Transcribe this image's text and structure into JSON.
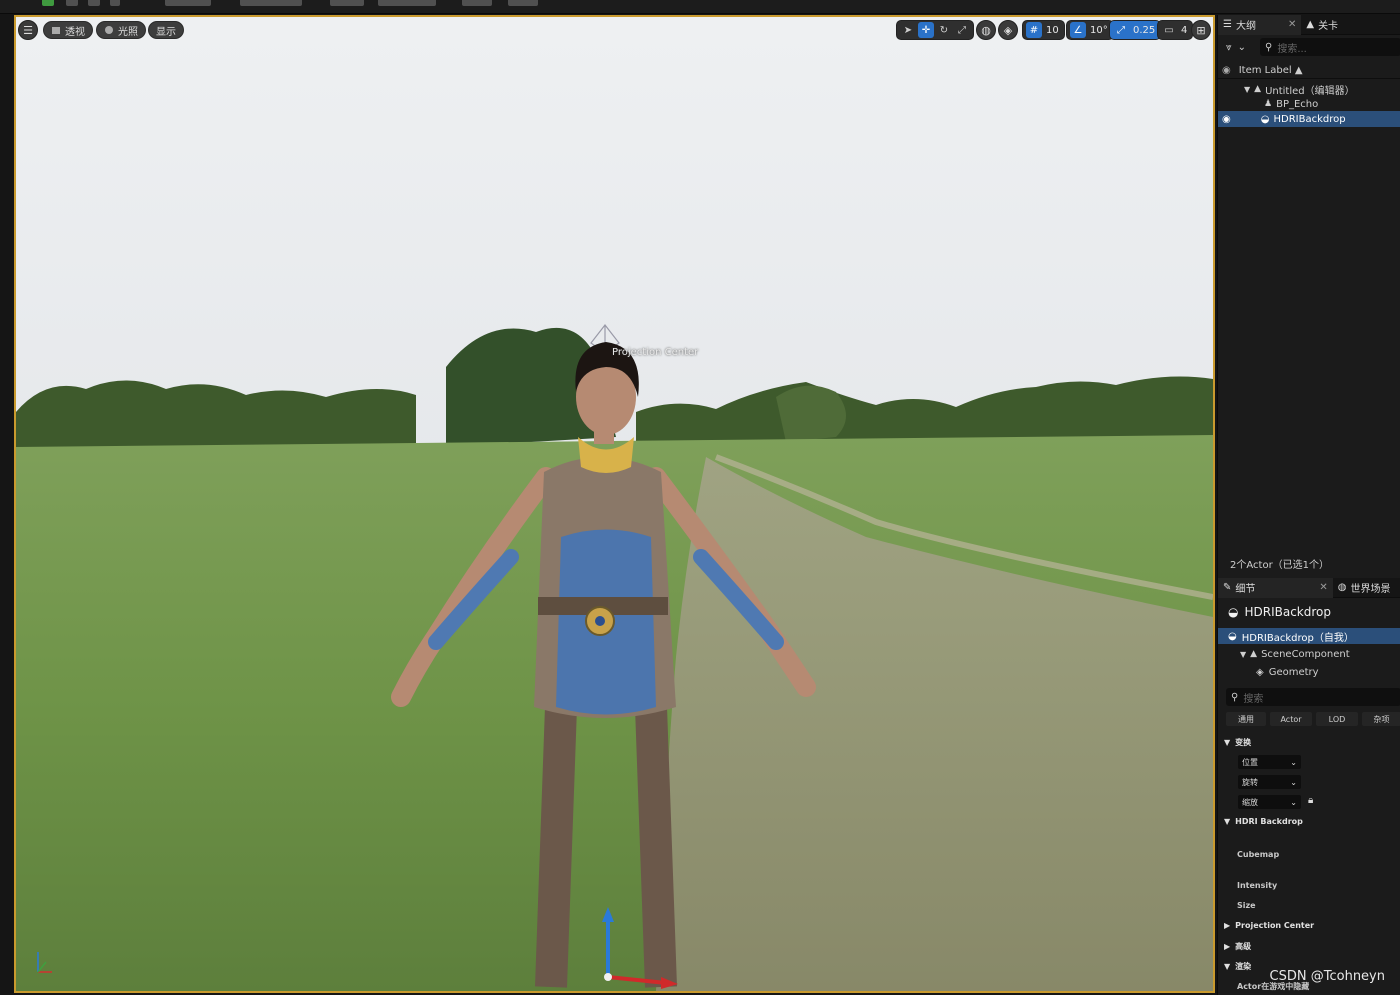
{
  "viewport": {
    "left_buttons": [
      {
        "icon": "menu-icon",
        "label": ""
      },
      {
        "icon": "cube-icon",
        "label": "透视"
      },
      {
        "icon": "sphere-icon",
        "label": "光照"
      },
      {
        "icon": "",
        "label": "显示"
      }
    ],
    "grid_snap_value": "10",
    "rotation_snap_value": "10°",
    "scale_snap_value": "0.25",
    "camera_speed_value": "4",
    "projection_center_label": "Projection Center",
    "accent_color": "#c99a2e"
  },
  "outliner": {
    "tab_label": "大纲",
    "second_tab_label": "关卡",
    "search_placeholder": "搜索...",
    "column_header": "Item Label ▲",
    "items": [
      {
        "label": "Untitled（编辑器）",
        "icon": "level-icon"
      },
      {
        "label": "BP_Echo",
        "icon": "character-icon"
      },
      {
        "label": "HDRIBackdrop",
        "icon": "actor-icon"
      }
    ],
    "status_text": "2个Actor（已选1个）"
  },
  "details": {
    "tab_label": "细节",
    "second_tab_label": "世界场景",
    "actor_name": "HDRIBackdrop",
    "component_tree": [
      {
        "label": "HDRIBackdrop（自我）"
      },
      {
        "label": "SceneComponent"
      },
      {
        "label": "Geometry"
      }
    ],
    "search_placeholder": "搜索",
    "filter_tabs": [
      "通用",
      "Actor",
      "LOD",
      "杂项"
    ],
    "transform_section": "变换",
    "transform_dropdowns": [
      "位置",
      "旋转",
      "缩放"
    ],
    "hdri_section": "HDRI Backdrop",
    "hdri_props": [
      "Cubemap",
      "Intensity",
      "Size"
    ],
    "projection_center_section": "Projection Center",
    "advanced_section": "高级",
    "render_section": "渲染",
    "render_prop": "Actor在游戏中隐藏"
  },
  "watermark": "CSDN @Tcohneyn",
  "colors": {
    "selection_blue": "#2b4f7a",
    "toolbar_blue": "#2a72c9",
    "panel_bg": "#1b1b1b"
  }
}
